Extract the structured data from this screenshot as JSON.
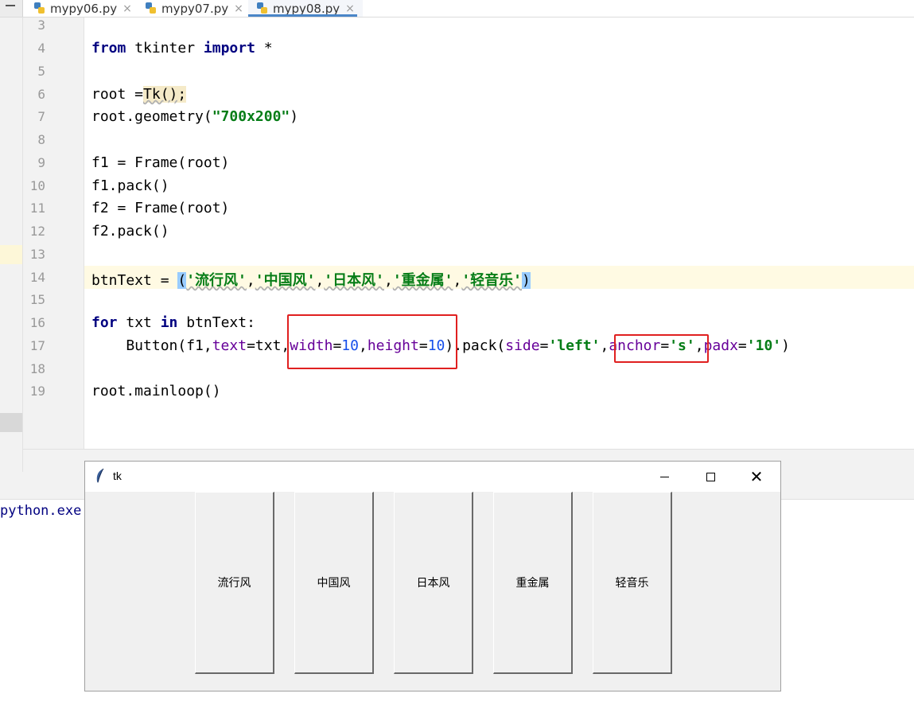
{
  "tabs": [
    {
      "label": "mypy06.py",
      "active": false
    },
    {
      "label": "mypy07.py",
      "active": false
    },
    {
      "label": "mypy08.py",
      "active": true
    }
  ],
  "tab_close_glyph": "×",
  "code": {
    "ln3": "3",
    "ln4": "4",
    "ln5": "5",
    "ln6": "6",
    "ln7": "7",
    "ln8": "8",
    "ln9": "9",
    "ln10": "10",
    "ln11": "11",
    "ln12": "12",
    "ln13": "13",
    "ln14": "14",
    "ln15": "15",
    "ln16": "16",
    "ln17": "17",
    "ln18": "18",
    "ln19": "19",
    "l4_kw1": "from",
    "l4_mid": " tkinter ",
    "l4_kw2": "import",
    "l4_end": " *",
    "l6_a": "root =",
    "l6_b": "Tk()",
    "l6_c": ";",
    "l7_a": "root.geometry(",
    "l7_str": "\"700x200\"",
    "l7_c": ")",
    "l9": "f1 = Frame(root)",
    "l10": "f1.pack()",
    "l11": "f2 = Frame(root)",
    "l12": "f2.pack()",
    "l14_a": "btnText = ",
    "l14_open": "(",
    "l14_s1": "'流行风'",
    "l14_s2": "'中国风'",
    "l14_s3": "'日本风'",
    "l14_s4": "'重金属'",
    "l14_s5": "'轻音乐'",
    "l14_close": ")",
    "l14_comma": ",",
    "l16_kw1": "for",
    "l16_mid": " txt ",
    "l16_kw2": "in",
    "l16_end": " btnText:",
    "l17_a": "    Button(f1,",
    "l17_p1": "text",
    "l17_b": "=txt,",
    "l17_p2": "width",
    "l17_eq": "=",
    "l17_n1": "10",
    "l17_comma": ",",
    "l17_p3": "height",
    "l17_n2": "10",
    "l17_c": ").pack(",
    "l17_p4": "side",
    "l17_s1": "'left'",
    "l17_p5": "anchor",
    "l17_s2": "'s'",
    "l17_p6": "padx",
    "l17_s3": "'10'",
    "l17_end": ")",
    "l19": "root.mainloop()"
  },
  "console_text": "python.exe",
  "tk_window": {
    "title": "tk",
    "close_glyph": "✕",
    "buttons": [
      "流行风",
      "中国风",
      "日本风",
      "重金属",
      "轻音乐"
    ]
  },
  "colors": {
    "keyword": "#000080",
    "string": "#067d17",
    "number": "#1750eb",
    "param": "#660099",
    "highlight_box": "#e02020",
    "current_line": "#fffae3"
  }
}
